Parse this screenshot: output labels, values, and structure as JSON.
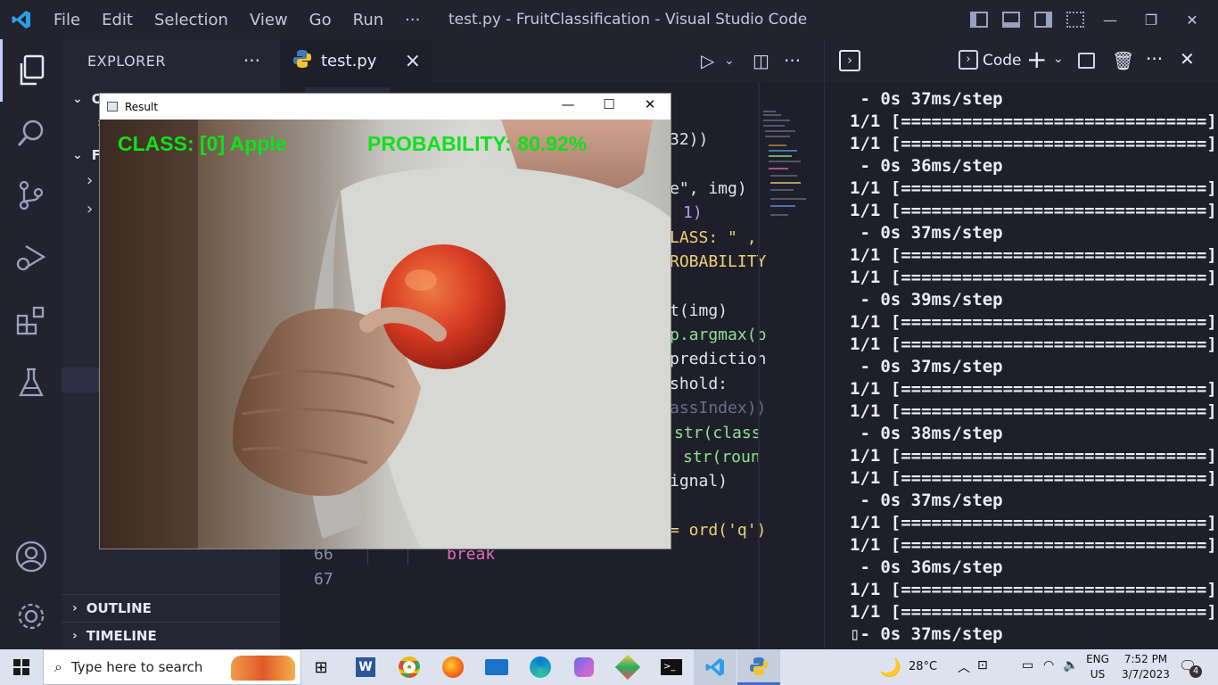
{
  "titlebar": {
    "menu": [
      "File",
      "Edit",
      "Selection",
      "View",
      "Go",
      "Run",
      "···"
    ],
    "window_title": "test.py - FruitClassification - Visual Studio Code"
  },
  "sidebar": {
    "title": "EXPLORER",
    "more": "···",
    "sections": [
      "O",
      "FR",
      "OUTLINE",
      "TIMELINE"
    ]
  },
  "editor": {
    "tab_label": "test.py",
    "line_numbers": [
      "66",
      "67"
    ],
    "visible_fragments": [
      "32))",
      "e\", img)",
      "1)",
      "LASS: \" ,",
      "ROBABILITY",
      "t(img)",
      "p.argmax(p",
      "prediction",
      "shold:",
      "assIndex))",
      "str(class",
      "str(roun",
      "ignal)",
      "= ord('q')",
      "break"
    ]
  },
  "result_window": {
    "title": "Result",
    "overlay_class": "CLASS:  [0] Apple",
    "overlay_probability": "PROBABILITY: 80.92%"
  },
  "terminal": {
    "profile_label": "Code",
    "lines": [
      " - 0s 37ms/step",
      "1/1 [==============================]",
      "1/1 [==============================]",
      " - 0s 36ms/step",
      "1/1 [==============================]",
      "1/1 [==============================]",
      " - 0s 37ms/step",
      "1/1 [==============================]",
      "1/1 [==============================]",
      " - 0s 39ms/step",
      "1/1 [==============================]",
      "1/1 [==============================]",
      " - 0s 37ms/step",
      "1/1 [==============================]",
      "1/1 [==============================]",
      " - 0s 38ms/step",
      "1/1 [==============================]",
      "1/1 [==============================]",
      " - 0s 37ms/step",
      "1/1 [==============================]",
      "1/1 [==============================]",
      " - 0s 36ms/step",
      "1/1 [==============================]",
      "1/1 [==============================]",
      "▯- 0s 37ms/step"
    ]
  },
  "taskbar": {
    "search_placeholder": "Type here to search",
    "weather": "28°C",
    "language": "ENG",
    "region": "US",
    "time": "7:52 PM",
    "date": "3/7/2023",
    "notifications": "4"
  },
  "colors": {
    "accent_green": "#10e11a",
    "vscode_blue": "#2f9ee8",
    "keyword_pink": "#e06ac0"
  }
}
